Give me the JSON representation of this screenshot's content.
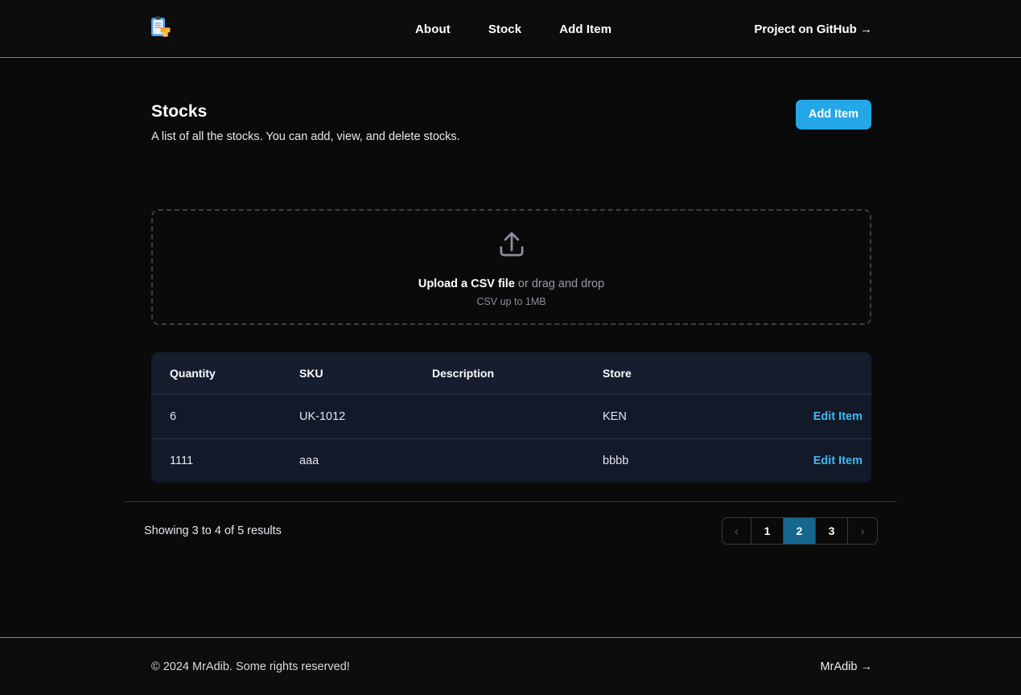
{
  "header": {
    "logo_icon": "clipboard-boxes-icon",
    "nav": [
      {
        "label": "About"
      },
      {
        "label": "Stock"
      },
      {
        "label": "Add Item"
      }
    ],
    "github_link": "Project on GitHub →"
  },
  "main": {
    "title": "Stocks",
    "subtitle": "A list of all the stocks. You can add, view, and delete stocks.",
    "add_item_label": "Add Item",
    "upload": {
      "icon": "upload-arrow-icon",
      "link_text": "Upload a CSV file",
      "rest_text": " or drag and drop",
      "hint": "CSV up to 1MB"
    },
    "table": {
      "columns": [
        "Quantity",
        "SKU",
        "Description",
        "Store"
      ],
      "action_label": "Edit Item",
      "rows": [
        {
          "quantity": "6",
          "sku": "UK-1012",
          "description": "",
          "store": "KEN",
          "action": "Edit Item"
        },
        {
          "quantity": "1111",
          "sku": "aaa",
          "description": "",
          "store": "bbbb",
          "action": "Edit Item"
        }
      ]
    },
    "pagination": {
      "info": "Showing 3 to 4 of 5 results",
      "prev_icon": "‹",
      "next_icon": "›",
      "pages": [
        "1",
        "2",
        "3"
      ],
      "active_page": "2"
    }
  },
  "footer": {
    "copyright": "© 2024 MrAdib. Some rights reserved!",
    "author_link": "MrAdib →"
  },
  "colors": {
    "background": "#0a0a0b",
    "accent_border": "#b5762a",
    "primary_button": "#24a7e8",
    "link": "#3fb9ef",
    "active_page": "#15678f",
    "table_bg": "#121928",
    "table_header_bg": "#151d2e"
  }
}
